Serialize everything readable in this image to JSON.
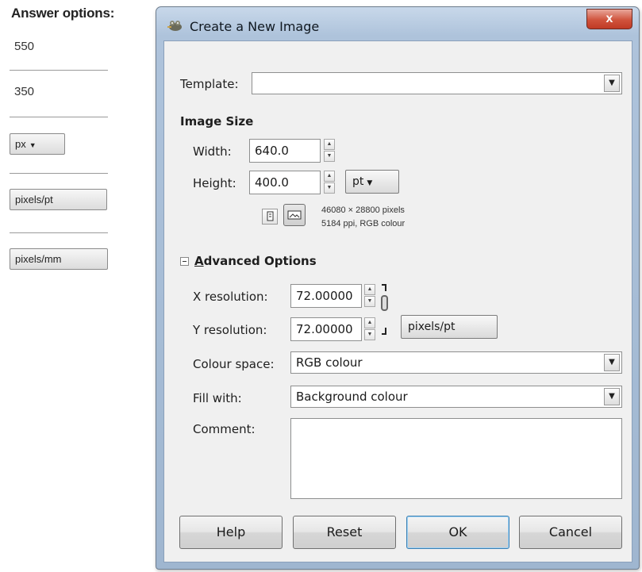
{
  "answers": {
    "title": "Answer options:",
    "text_options": [
      "550",
      "350"
    ],
    "button_options": [
      {
        "label": "px",
        "has_dropdown": true
      },
      {
        "label": "pixels/pt",
        "has_dropdown": false
      },
      {
        "label": "pixels/mm",
        "has_dropdown": false
      }
    ]
  },
  "dialog": {
    "title": "Create a New Image",
    "close_label": "x",
    "template": {
      "label": "Template:",
      "value": ""
    },
    "image_size": {
      "heading": "Image Size",
      "width_label": "Width:",
      "width_value": "640.0",
      "height_label": "Height:",
      "height_value": "400.0",
      "unit": "pt",
      "info_line1": "46080 × 28800 pixels",
      "info_line2": "5184 ppi, RGB colour"
    },
    "advanced": {
      "heading": "Advanced Options",
      "x_res_label": "X resolution:",
      "x_res_value": "72.00000",
      "y_res_label": "Y resolution:",
      "y_res_value": "72.00000",
      "res_unit": "pixels/pt",
      "colour_space_label": "Colour space:",
      "colour_space_value": "RGB colour",
      "fill_label": "Fill with:",
      "fill_value": "Background colour",
      "comment_label": "Comment:",
      "comment_value": ""
    },
    "buttons": {
      "help": "Help",
      "reset": "Reset",
      "ok": "OK",
      "cancel": "Cancel"
    }
  },
  "icons": {
    "title_icon": "gimp-wilber-icon",
    "portrait_icon": "portrait-orientation-icon",
    "landscape_icon": "landscape-orientation-icon",
    "chain_icon": "chain-link-icon",
    "expander_icon": "collapse-minus-icon",
    "dropdown_icon": "chevron-down-icon"
  }
}
